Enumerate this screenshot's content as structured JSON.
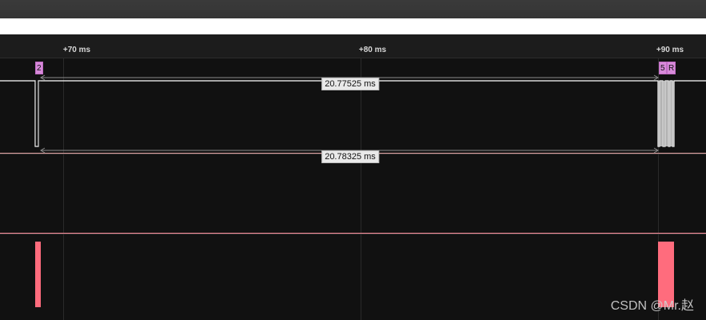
{
  "window": {
    "title": ""
  },
  "timeline": {
    "ticks": [
      {
        "label": "+70 ms"
      },
      {
        "label": "+80 ms"
      },
      {
        "label": "+90 ms"
      }
    ]
  },
  "markers": [
    {
      "label": "2",
      "color": "#d78ad9"
    },
    {
      "label": "5",
      "color": "#d78ad9"
    },
    {
      "label": "R",
      "color": "#d78ad9"
    }
  ],
  "measurements": [
    {
      "label": "20.77525 ms"
    },
    {
      "label": "20.78325 ms"
    }
  ],
  "channels": [
    {
      "name": "",
      "color": "#ffffff"
    },
    {
      "name": "",
      "color": "#111111"
    },
    {
      "name": "",
      "color": "#ff6c7d"
    }
  ],
  "watermark": {
    "text": "CSDN @Mr.赵"
  },
  "colors": {
    "background": "#111111",
    "ruler": "#1c1c1c",
    "signal_white": "#ffffff",
    "signal_red": "#ff6c7d",
    "marker": "#d78ad9",
    "measurement": "#e9e9e9"
  }
}
